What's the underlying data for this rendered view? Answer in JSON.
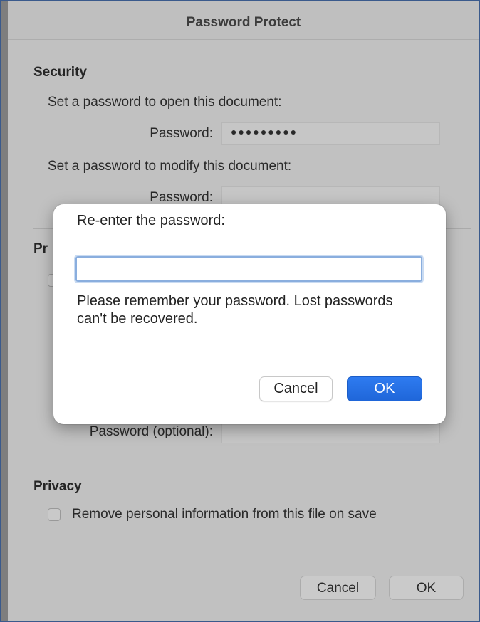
{
  "window": {
    "title": "Password Protect"
  },
  "security": {
    "heading": "Security",
    "open_prompt": "Set a password to open this document:",
    "open_label": "Password:",
    "open_value": "●●●●●●●●●",
    "modify_prompt": "Set a password to modify this document:",
    "modify_label": "Password:",
    "modify_value": ""
  },
  "protection": {
    "heading_partial": "Pr",
    "password_optional_label": "Password (optional):",
    "password_optional_value": ""
  },
  "privacy": {
    "heading": "Privacy",
    "remove_info_label": "Remove personal information from this file on save",
    "remove_info_checked": false
  },
  "footer": {
    "cancel_label": "Cancel",
    "ok_label": "OK"
  },
  "modal": {
    "title": "Re-enter the password:",
    "input_value": "",
    "note": "Please remember your password. Lost passwords can't be recovered.",
    "cancel_label": "Cancel",
    "ok_label": "OK"
  },
  "colors": {
    "accent": "#2e7bf0",
    "focus_ring": "#8aaede"
  }
}
